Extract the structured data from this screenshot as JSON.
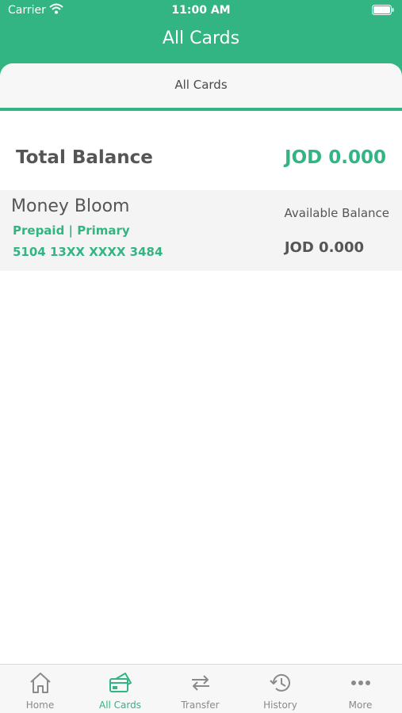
{
  "status_bar": {
    "carrier": "Carrier",
    "time": "11:00 AM"
  },
  "nav": {
    "title": "All Cards"
  },
  "segment": {
    "label": "All Cards"
  },
  "total": {
    "label": "Total Balance",
    "value": "JOD 0.000"
  },
  "card": {
    "name": "Money Bloom",
    "type": "Prepaid | Primary",
    "number": "5104 13XX XXXX 3484",
    "available_label": "Available Balance",
    "available_value": "JOD 0.000"
  },
  "tabs": [
    {
      "label": "Home",
      "icon": "home-icon"
    },
    {
      "label": "All Cards",
      "icon": "cards-icon",
      "active": true
    },
    {
      "label": "Transfer",
      "icon": "transfer-icon"
    },
    {
      "label": "History",
      "icon": "history-icon"
    },
    {
      "label": "More",
      "icon": "more-icon"
    }
  ],
  "colors": {
    "accent": "#33b583",
    "text": "#555555",
    "tab_inactive": "#8a8a8a"
  }
}
